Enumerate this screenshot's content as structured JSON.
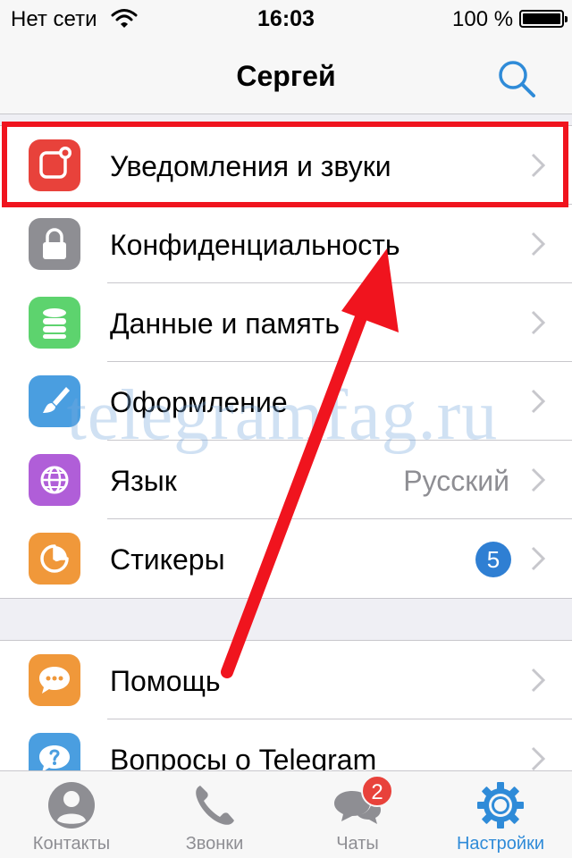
{
  "status_bar": {
    "carrier": "Нет сети",
    "time": "16:03",
    "battery": "100 %"
  },
  "header": {
    "title": "Сергей",
    "search_icon": "search-icon"
  },
  "settings": {
    "group1": [
      {
        "label": "Уведомления и звуки",
        "icon": "notification-icon",
        "color": "#e8423b"
      },
      {
        "label": "Конфиденциальность",
        "icon": "lock-icon",
        "color": "#8e8e93"
      },
      {
        "label": "Данные и память",
        "icon": "data-storage-icon",
        "color": "#5dd36e"
      },
      {
        "label": "Оформление",
        "icon": "brush-icon",
        "color": "#4a9ee0"
      },
      {
        "label": "Язык",
        "value": "Русский",
        "icon": "globe-icon",
        "color": "#b05ed8"
      },
      {
        "label": "Стикеры",
        "badge": "5",
        "icon": "sticker-icon",
        "color": "#f0983a"
      }
    ],
    "group2": [
      {
        "label": "Помощь",
        "icon": "chat-bubble-icon",
        "color": "#f0983a"
      },
      {
        "label": "Вопросы о Telegram",
        "icon": "question-icon",
        "color": "#4a9ee0"
      }
    ]
  },
  "watermark": "telegramfag.ru",
  "tab_bar": {
    "tabs": [
      {
        "label": "Контакты",
        "icon": "person-icon"
      },
      {
        "label": "Звонки",
        "icon": "phone-icon"
      },
      {
        "label": "Чаты",
        "icon": "chats-icon",
        "badge": "2"
      },
      {
        "label": "Настройки",
        "icon": "gear-icon",
        "active": true
      }
    ]
  },
  "colors": {
    "accent": "#2f8bd8",
    "highlight": "#f0141e",
    "badge_red": "#e8423b",
    "badge_blue": "#2f7fd3"
  }
}
